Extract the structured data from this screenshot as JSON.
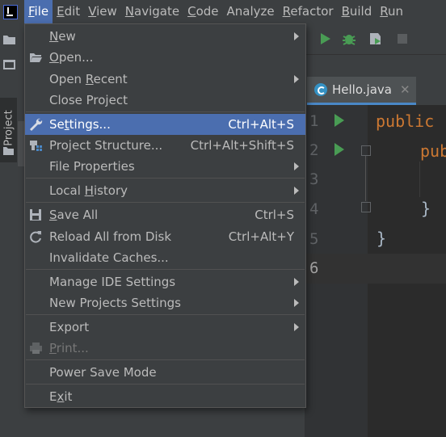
{
  "menubar": {
    "items": [
      {
        "label": "File",
        "mnemonic": "F",
        "rest": "ile"
      },
      {
        "label": "Edit",
        "mnemonic": "E",
        "rest": "dit"
      },
      {
        "label": "View",
        "mnemonic": "V",
        "rest": "iew"
      },
      {
        "label": "Navigate",
        "mnemonic": "N",
        "rest": "avigate"
      },
      {
        "label": "Code",
        "mnemonic": "C",
        "rest": "ode"
      },
      {
        "label": "Analyze",
        "mnemonic": "",
        "rest": "Analyze"
      },
      {
        "label": "Refactor",
        "mnemonic": "R",
        "rest": "efactor"
      },
      {
        "label": "Build",
        "mnemonic": "B",
        "rest": "uild"
      },
      {
        "label": "Run",
        "mnemonic": "R",
        "rest": "un"
      }
    ]
  },
  "sidebar": {
    "project_tab": "Project"
  },
  "editor": {
    "tab_name": "Hello.java",
    "tab_close": "✕",
    "line_numbers": [
      "1",
      "2",
      "3",
      "4",
      "5",
      "6"
    ],
    "code": {
      "line1": "public",
      "line2": "pub",
      "line4": "}",
      "line5": "}"
    }
  },
  "file_menu": {
    "items": [
      {
        "pre": "",
        "mn": "N",
        "post": "ew",
        "shortcut": "",
        "submenu": true
      },
      {
        "pre": "",
        "mn": "O",
        "post": "pen...",
        "shortcut": "",
        "submenu": false
      },
      {
        "pre": "Open ",
        "mn": "R",
        "post": "ecent",
        "shortcut": "",
        "submenu": true
      },
      {
        "pre": "Close Project",
        "mn": "",
        "post": "",
        "shortcut": "",
        "submenu": false
      },
      {
        "pre": "Se",
        "mn": "t",
        "post": "tings...",
        "shortcut": "Ctrl+Alt+S",
        "submenu": false
      },
      {
        "pre": "Project Structure...",
        "mn": "",
        "post": "",
        "shortcut": "Ctrl+Alt+Shift+S",
        "submenu": false
      },
      {
        "pre": "File Properties",
        "mn": "",
        "post": "",
        "shortcut": "",
        "submenu": true
      },
      {
        "pre": "Local ",
        "mn": "H",
        "post": "istory",
        "shortcut": "",
        "submenu": true
      },
      {
        "pre": "",
        "mn": "S",
        "post": "ave All",
        "shortcut": "Ctrl+S",
        "submenu": false
      },
      {
        "pre": "Reload All from Disk",
        "mn": "",
        "post": "",
        "shortcut": "Ctrl+Alt+Y",
        "submenu": false
      },
      {
        "pre": "Invalidate Caches...",
        "mn": "",
        "post": "",
        "shortcut": "",
        "submenu": false
      },
      {
        "pre": "Manage IDE Settings",
        "mn": "",
        "post": "",
        "shortcut": "",
        "submenu": true
      },
      {
        "pre": "New Projects Settings",
        "mn": "",
        "post": "",
        "shortcut": "",
        "submenu": true
      },
      {
        "pre": "Export",
        "mn": "",
        "post": "",
        "shortcut": "",
        "submenu": true
      },
      {
        "pre": "",
        "mn": "P",
        "post": "rint...",
        "shortcut": "",
        "submenu": false
      },
      {
        "pre": "Power Save Mode",
        "mn": "",
        "post": "",
        "shortcut": "",
        "submenu": false
      },
      {
        "pre": "E",
        "mn": "x",
        "post": "it",
        "shortcut": "",
        "submenu": false
      }
    ]
  },
  "colors": {
    "accent": "#4b6eaf",
    "run_green": "#499c54",
    "keyword": "#cc7832",
    "background": "#3c3f41",
    "editor_bg": "#2b2b2b"
  },
  "icons": {
    "toolbar": [
      "run-icon",
      "debug-icon",
      "coverage-icon",
      "stop-icon"
    ],
    "menu": [
      "open-folder-icon",
      "wrench-icon",
      "project-structure-icon",
      "save-icon",
      "reload-icon",
      "print-icon"
    ]
  }
}
